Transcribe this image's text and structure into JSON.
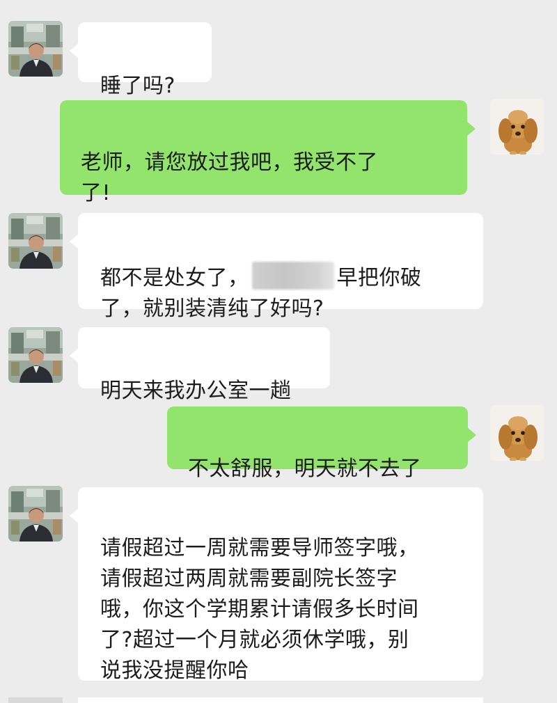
{
  "conversation": {
    "messages": [
      {
        "sender": "teacher",
        "avatar_icon": "teacher-portrait-icon",
        "text": "睡了吗?"
      },
      {
        "sender": "student",
        "avatar_icon": "puppy-avatar-icon",
        "text": "老师，请您放过我吧，我受不了\n了!"
      },
      {
        "sender": "teacher",
        "avatar_icon": "teacher-portrait-icon",
        "text_before_redaction": "都不是处女了，",
        "text_after_redaction": "早把你破\n了，就别装清纯了好吗?"
      },
      {
        "sender": "teacher",
        "avatar_icon": "teacher-portrait-icon",
        "text": "明天来我办公室一趟"
      },
      {
        "sender": "student",
        "avatar_icon": "puppy-avatar-icon",
        "text": "不太舒服，明天就不去了"
      },
      {
        "sender": "teacher",
        "avatar_icon": "teacher-portrait-icon",
        "text": "请假超过一周就需要导师签字哦，\n请假超过两周就需要副院长签字\n哦，你这个学期累计请假多长时间\n了?超过一个月就必须休学哦，别\n说我没提醒你哈"
      }
    ]
  },
  "colors": {
    "background": "#ececec",
    "incoming_bubble": "#ffffff",
    "outgoing_bubble": "#92e46d",
    "text": "#1c1c1c"
  }
}
